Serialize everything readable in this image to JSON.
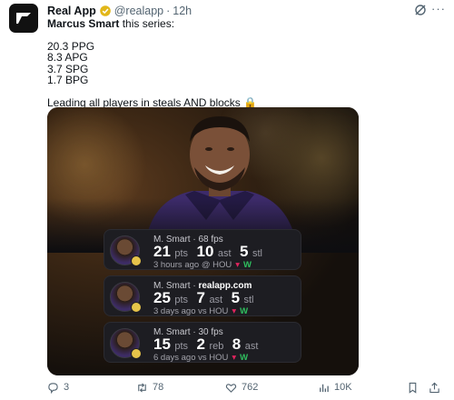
{
  "post": {
    "author_name": "Real App",
    "handle": "@realapp",
    "separator": "·",
    "time": "12h",
    "lines": [
      {
        "bold": "Marcus Smart",
        "rest": " this series:"
      },
      {
        "rest": "20.3 PPG"
      },
      {
        "rest": "8.3 APG"
      },
      {
        "rest": "3.7 SPG"
      },
      {
        "rest": "1.7 BPG"
      },
      {
        "rest": "Leading all players in steals AND blocks 🔒"
      }
    ]
  },
  "cards": [
    {
      "name": "M. Smart",
      "sep": " · ",
      "meta": "68 fps",
      "meta_is_site": false,
      "stats": [
        {
          "value": "21",
          "unit": "pts"
        },
        {
          "value": "10",
          "unit": "ast"
        },
        {
          "value": "5",
          "unit": "stl"
        }
      ],
      "when": "3 hours ago @ HOU",
      "result": "W"
    },
    {
      "name": "M. Smart",
      "sep": " · ",
      "meta": "realapp.com",
      "meta_is_site": true,
      "stats": [
        {
          "value": "25",
          "unit": "pts"
        },
        {
          "value": "7",
          "unit": "ast"
        },
        {
          "value": "5",
          "unit": "stl"
        }
      ],
      "when": "3 days ago vs HOU",
      "result": "W"
    },
    {
      "name": "M. Smart",
      "sep": " · ",
      "meta": "30 fps",
      "meta_is_site": false,
      "stats": [
        {
          "value": "15",
          "unit": "pts"
        },
        {
          "value": "2",
          "unit": "reb"
        },
        {
          "value": "8",
          "unit": "ast"
        }
      ],
      "when": "6 days ago vs HOU",
      "result": "W"
    }
  ],
  "actions": {
    "replies": "3",
    "reposts": "78",
    "likes": "762",
    "views": "10K"
  },
  "colors": {
    "verified": "#e2b719",
    "win": "#2fbf5f",
    "loss_marker": "#e0245e",
    "card_bg": "#1d1d22"
  },
  "icons": [
    "reply-icon",
    "repost-icon",
    "like-icon",
    "views-icon",
    "bookmark-icon",
    "share-icon",
    "grok-icon",
    "more-icon",
    "verified-icon"
  ]
}
